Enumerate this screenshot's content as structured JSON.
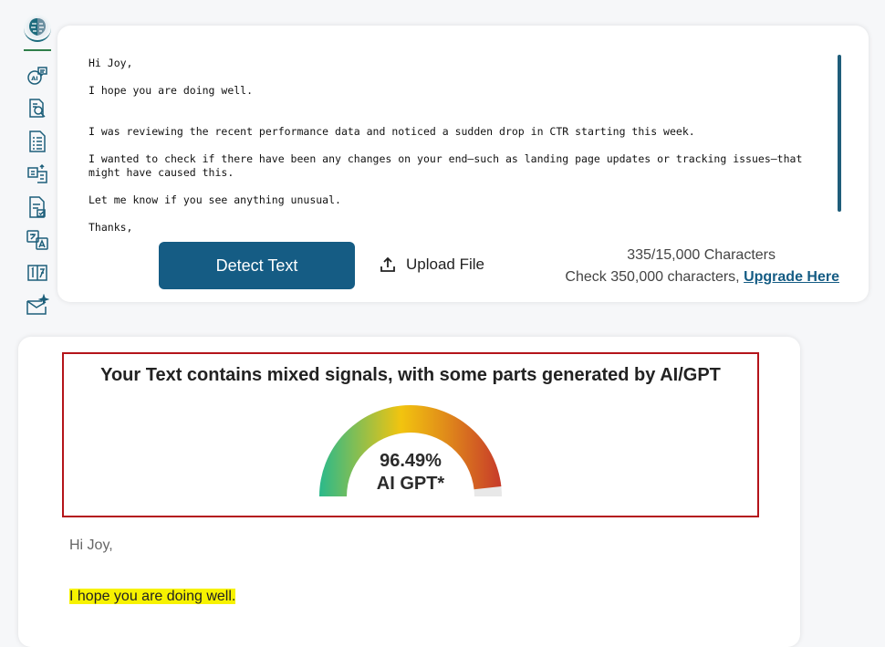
{
  "sidebar": {
    "items": [
      {
        "icon": "brain-logo-icon"
      },
      {
        "icon": "ai-chat-icon"
      },
      {
        "icon": "document-search-icon"
      },
      {
        "icon": "document-list-icon"
      },
      {
        "icon": "paraphrase-icon"
      },
      {
        "icon": "document-check-icon"
      },
      {
        "icon": "translate-icon"
      },
      {
        "icon": "number-grid-icon"
      },
      {
        "icon": "mail-sparkle-icon"
      }
    ]
  },
  "input": {
    "lines": [
      "Hi Joy,",
      "I hope you are doing well.",
      "I was reviewing the recent performance data and noticed a sudden drop in CTR starting this week.",
      "I wanted to check if there have been any changes on your end—such as landing page updates or tracking issues—that might have caused this.",
      "Let me know if you see anything unusual.",
      "Thanks,"
    ]
  },
  "actions": {
    "detect_label": "Detect Text",
    "upload_label": "Upload File"
  },
  "characters": {
    "count_text": "335/15,000 Characters",
    "check_text": "Check 350,000 characters,",
    "upgrade_label": "Upgrade Here"
  },
  "result": {
    "title": "Your Text contains mixed signals, with some parts generated by AI/GPT",
    "value": "96.49%",
    "label": "AI GPT*",
    "value_number": 96.49,
    "gauge_colors": [
      "#2ab98b",
      "#f2c40f",
      "#e08a1a",
      "#c73a2a"
    ]
  },
  "analysis": {
    "greeting": "Hi Joy,",
    "highlighted": "I hope you are doing well.",
    "highlight_color": "#f7f200"
  },
  "colors": {
    "primary": "#155c84",
    "alert_border": "#b4141a"
  }
}
